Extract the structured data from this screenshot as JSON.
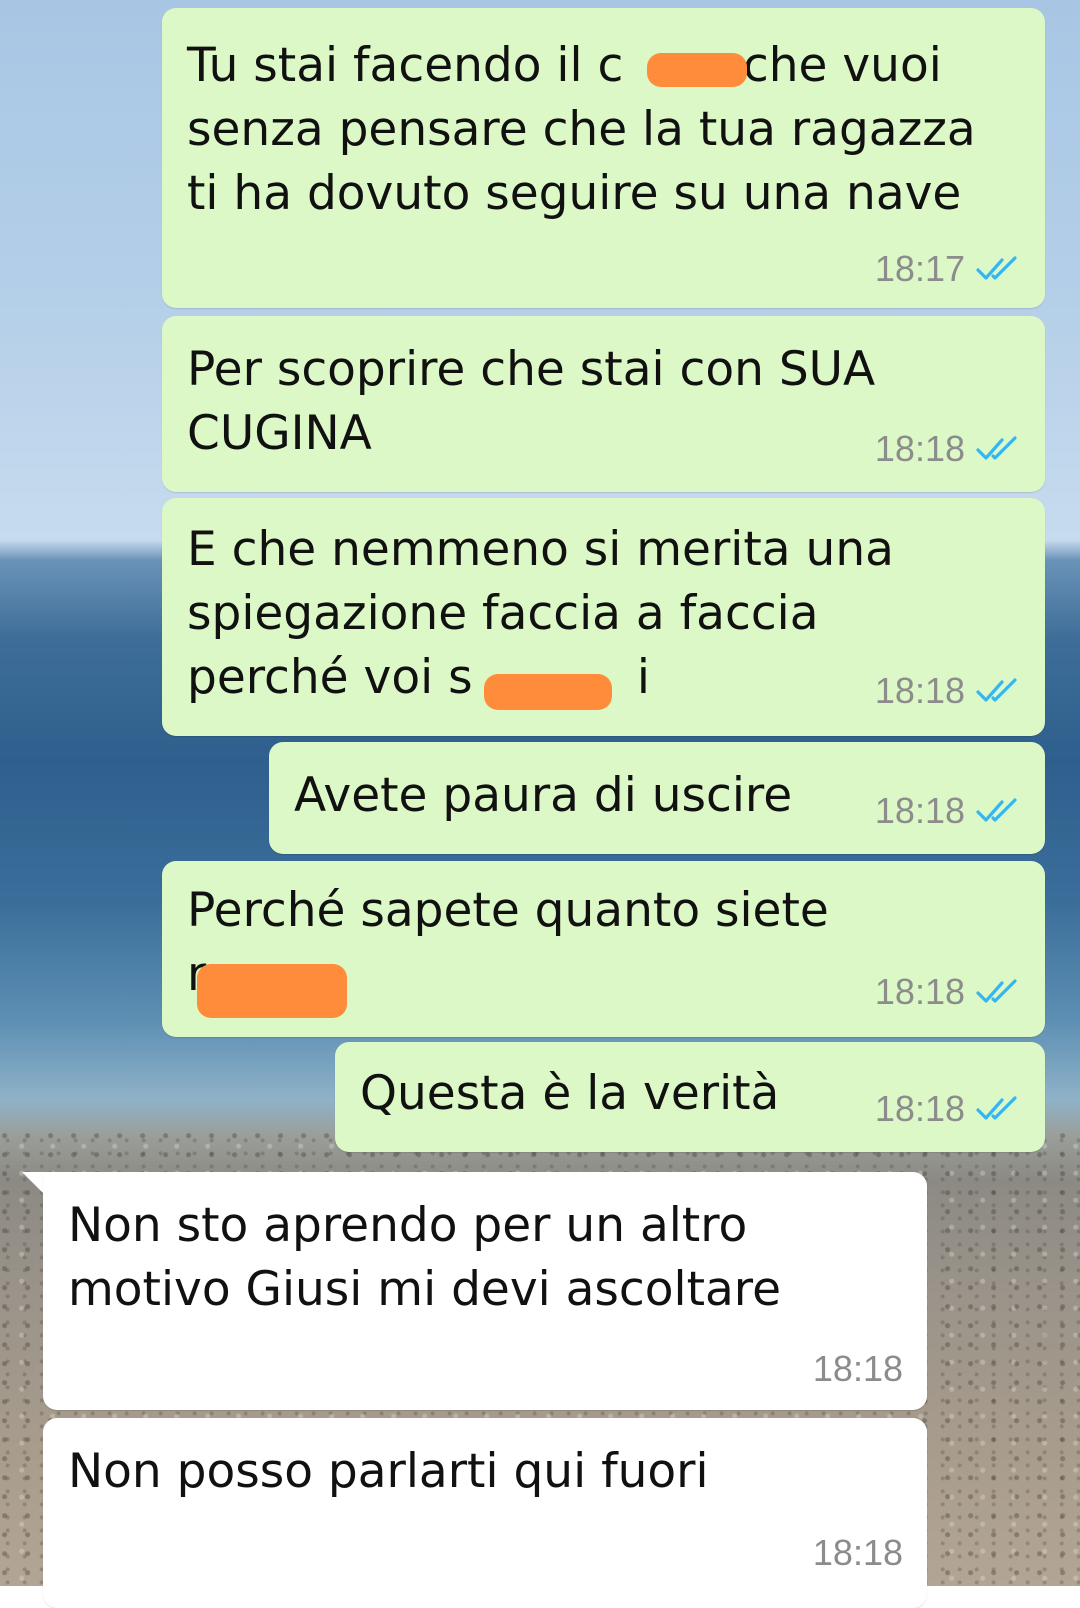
{
  "chat": {
    "wallpaper": "sea-and-beach",
    "colors": {
      "outgoing_bubble": "#dcf8c6",
      "incoming_bubble": "#ffffff",
      "read_ticks": "#34b7f1",
      "redaction": "#ff8c3a"
    },
    "messages": [
      {
        "direction": "out",
        "text": "Tu stai facendo il c        che vuoi\nsenza pensare che la tua ragazza\nti ha dovuto seguire su una nave",
        "time": "18:17",
        "status": "read"
      },
      {
        "direction": "out",
        "text": "Per scoprire che stai con SUA\nCUGINA",
        "time": "18:18",
        "status": "read"
      },
      {
        "direction": "out",
        "text": "E che nemmeno si merita una\nspiegazione faccia a faccia\nperché voi s           i",
        "time": "18:18",
        "status": "read"
      },
      {
        "direction": "out",
        "text": "Avete paura di uscire",
        "time": "18:18",
        "status": "read"
      },
      {
        "direction": "out",
        "text": "Perché sapete quanto siete\nr",
        "time": "18:18",
        "status": "read"
      },
      {
        "direction": "out",
        "text": "Questa è la verità",
        "time": "18:18",
        "status": "read"
      },
      {
        "direction": "in",
        "text": "Non sto aprendo per un altro\nmotivo Giusi mi devi ascoltare",
        "time": "18:18"
      },
      {
        "direction": "in",
        "text": "Non posso parlarti qui fuori",
        "time": "18:18"
      }
    ]
  }
}
